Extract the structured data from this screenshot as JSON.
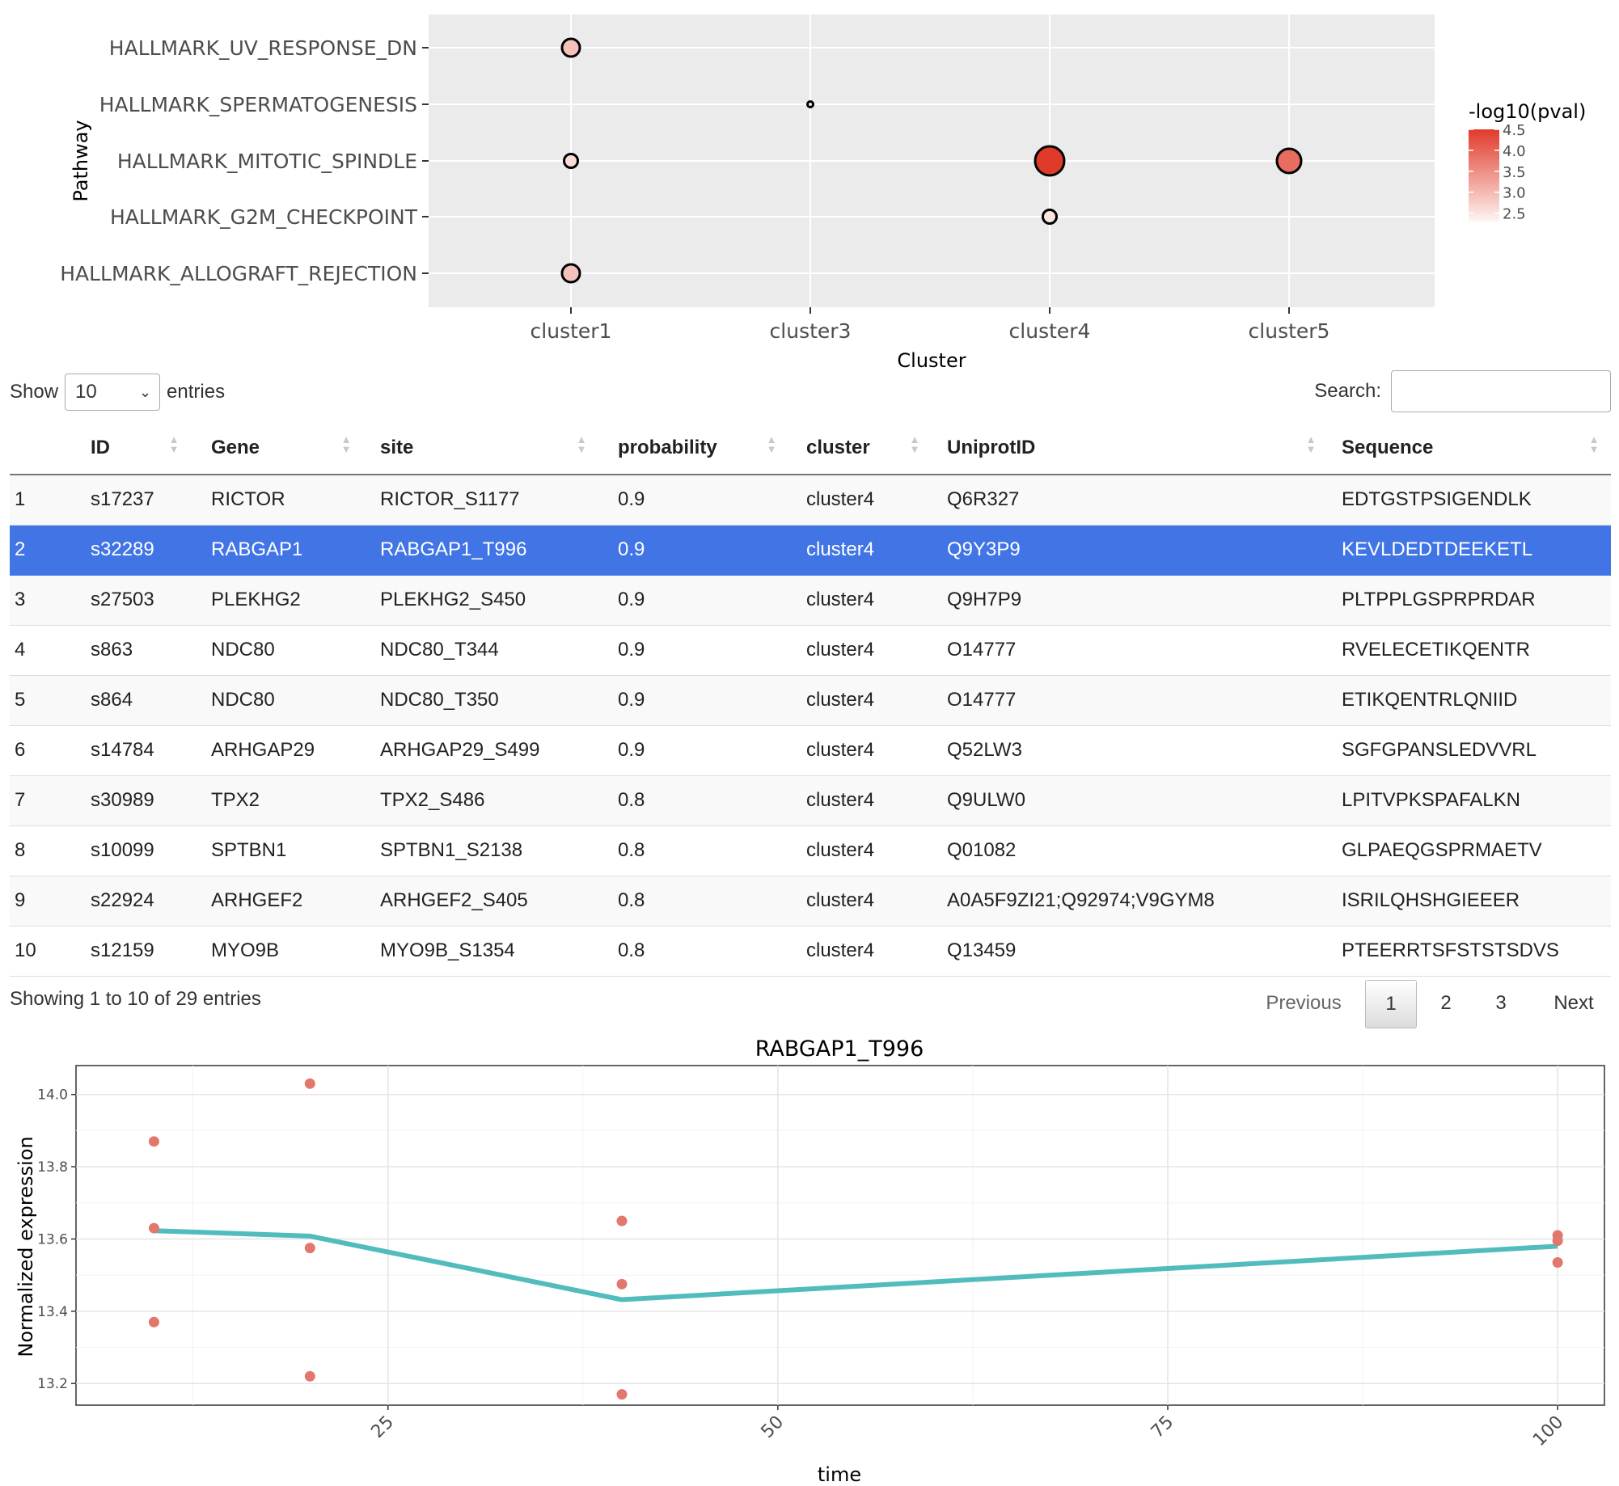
{
  "chart_data": [
    {
      "type": "scatter",
      "variant": "dot-plot",
      "xlabel": "Cluster",
      "ylabel": "Pathway",
      "categories": [
        "cluster1",
        "cluster3",
        "cluster4",
        "cluster5"
      ],
      "pathways": [
        "HALLMARK_UV_RESPONSE_DN",
        "HALLMARK_SPERMATOGENESIS",
        "HALLMARK_MITOTIC_SPINDLE",
        "HALLMARK_G2M_CHECKPOINT",
        "HALLMARK_ALLOGRAFT_REJECTION"
      ],
      "legend_title": "-log10(pval)",
      "legend_ticks": [
        "4.5",
        "4.0",
        "3.5",
        "3.0",
        "2.5"
      ],
      "legend_range": [
        2.3,
        4.5
      ],
      "legend_placement": "right",
      "color_low": "#fdf5f2",
      "color_high": "#e03a2a",
      "grid": true,
      "panel_background": "#ebebeb",
      "points": [
        {
          "cluster": "cluster1",
          "pathway": "HALLMARK_UV_RESPONSE_DN",
          "value": 2.9,
          "size": 3
        },
        {
          "cluster": "cluster3",
          "pathway": "HALLMARK_SPERMATOGENESIS",
          "value": 2.4,
          "size": 1
        },
        {
          "cluster": "cluster1",
          "pathway": "HALLMARK_MITOTIC_SPINDLE",
          "value": 2.6,
          "size": 2
        },
        {
          "cluster": "cluster4",
          "pathway": "HALLMARK_MITOTIC_SPINDLE",
          "value": 4.5,
          "size": 5
        },
        {
          "cluster": "cluster5",
          "pathway": "HALLMARK_MITOTIC_SPINDLE",
          "value": 3.9,
          "size": 4
        },
        {
          "cluster": "cluster4",
          "pathway": "HALLMARK_G2M_CHECKPOINT",
          "value": 2.5,
          "size": 2
        },
        {
          "cluster": "cluster1",
          "pathway": "HALLMARK_ALLOGRAFT_REJECTION",
          "value": 2.9,
          "size": 3
        }
      ]
    },
    {
      "type": "scatter",
      "title": "RABGAP1_T996",
      "xlabel": "time",
      "ylabel": "Normalized expression",
      "xlim": [
        5,
        103
      ],
      "ylim": [
        13.14,
        14.08
      ],
      "xticks": [
        25,
        50,
        75,
        100
      ],
      "yticks": [
        13.2,
        13.4,
        13.6,
        13.8,
        14.0
      ],
      "grid": true,
      "point_color": "#e2776c",
      "line_color": "#52bcbd",
      "points": [
        {
          "x": 10,
          "y": 13.87
        },
        {
          "x": 10,
          "y": 13.63
        },
        {
          "x": 10,
          "y": 13.37
        },
        {
          "x": 20,
          "y": 14.03
        },
        {
          "x": 20,
          "y": 13.575
        },
        {
          "x": 20,
          "y": 13.22
        },
        {
          "x": 40,
          "y": 13.65
        },
        {
          "x": 40,
          "y": 13.475
        },
        {
          "x": 40,
          "y": 13.17
        },
        {
          "x": 100,
          "y": 13.61
        },
        {
          "x": 100,
          "y": 13.595
        },
        {
          "x": 100,
          "y": 13.535
        }
      ],
      "line": [
        {
          "x": 10,
          "y": 13.623
        },
        {
          "x": 20,
          "y": 13.608
        },
        {
          "x": 40,
          "y": 13.432
        },
        {
          "x": 100,
          "y": 13.58
        }
      ]
    }
  ],
  "datatable": {
    "show_label": "Show",
    "length_value": "10",
    "entries_label": "entries",
    "search_label": "Search:",
    "search_value": "",
    "selection_color": "#4175e6",
    "columns": [
      "",
      "ID",
      "Gene",
      "site",
      "probability",
      "cluster",
      "UniprotID",
      "Sequence"
    ],
    "rows": [
      [
        "1",
        "s17237",
        "RICTOR",
        "RICTOR_S1177",
        "0.9",
        "cluster4",
        "Q6R327",
        "EDTGSTPSIGENDLK"
      ],
      [
        "2",
        "s32289",
        "RABGAP1",
        "RABGAP1_T996",
        "0.9",
        "cluster4",
        "Q9Y3P9",
        "KEVLDEDTDEEKETL"
      ],
      [
        "3",
        "s27503",
        "PLEKHG2",
        "PLEKHG2_S450",
        "0.9",
        "cluster4",
        "Q9H7P9",
        "PLTPPLGSPRPRDAR"
      ],
      [
        "4",
        "s863",
        "NDC80",
        "NDC80_T344",
        "0.9",
        "cluster4",
        "O14777",
        "RVELECETIKQENTR"
      ],
      [
        "5",
        "s864",
        "NDC80",
        "NDC80_T350",
        "0.9",
        "cluster4",
        "O14777",
        "ETIKQENTRLQNIID"
      ],
      [
        "6",
        "s14784",
        "ARHGAP29",
        "ARHGAP29_S499",
        "0.9",
        "cluster4",
        "Q52LW3",
        "SGFGPANSLEDVVRL"
      ],
      [
        "7",
        "s30989",
        "TPX2",
        "TPX2_S486",
        "0.8",
        "cluster4",
        "Q9ULW0",
        "LPITVPKSPAFALKN"
      ],
      [
        "8",
        "s10099",
        "SPTBN1",
        "SPTBN1_S2138",
        "0.8",
        "cluster4",
        "Q01082",
        "GLPAEQGSPRMAETV"
      ],
      [
        "9",
        "s22924",
        "ARHGEF2",
        "ARHGEF2_S405",
        "0.8",
        "cluster4",
        "A0A5F9ZI21;Q92974;V9GYM8",
        "ISRILQHSHGIEEER"
      ],
      [
        "10",
        "s12159",
        "MYO9B",
        "MYO9B_S1354",
        "0.8",
        "cluster4",
        "Q13459",
        "PTEERRTSFSTSTSDVS"
      ]
    ],
    "selected_row": 1,
    "info": "Showing 1 to 10 of 29 entries",
    "pagination": {
      "previous": "Previous",
      "pages": [
        "1",
        "2",
        "3"
      ],
      "current": "1",
      "next": "Next"
    }
  }
}
